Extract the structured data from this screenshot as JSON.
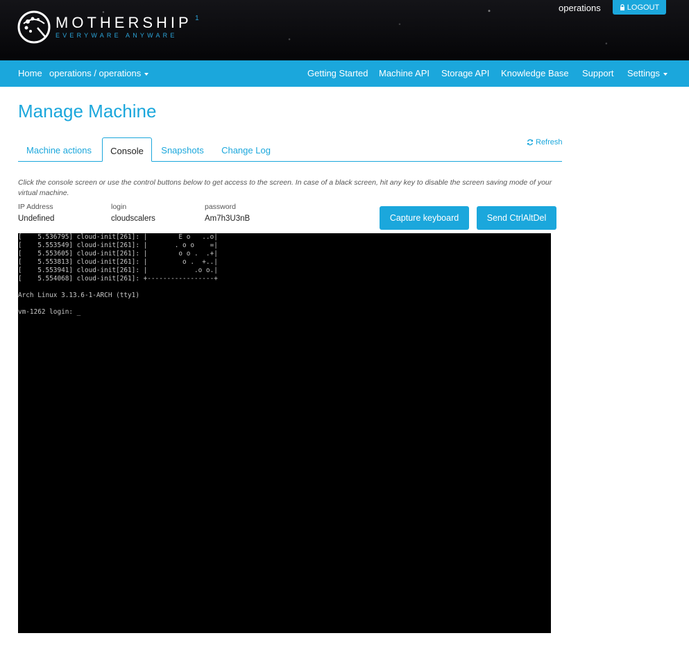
{
  "header": {
    "logo_word": "MOTHERSHIP",
    "logo_superscript": "1",
    "logo_tagline": "EVERYWARE ANYWARE",
    "user": "operations",
    "logout_label": "LOGOUT",
    "logout_icon": "lock-icon"
  },
  "nav": {
    "home": "Home",
    "context": "operations / operations",
    "items": [
      "Getting Started",
      "Machine API",
      "Storage API",
      "Knowledge Base",
      "Support"
    ],
    "settings": "Settings"
  },
  "page": {
    "title": "Manage Machine",
    "refresh": "Refresh",
    "tabs": [
      "Machine actions",
      "Console",
      "Snapshots",
      "Change Log"
    ],
    "active_tab": "Console",
    "hint": "Click the console screen or use the control buttons below to get access to the screen. In case of a black screen, hit any key to disable the screen saving mode of your virtual machine."
  },
  "machine": {
    "ip_label": "IP Address",
    "ip_value": "Undefined",
    "login_label": "login",
    "login_value": "cloudscalers",
    "password_label": "password",
    "password_value": "Am7h3U3nB"
  },
  "buttons": {
    "capture": "Capture keyboard",
    "ctrlaltdel": "Send CtrlAltDel"
  },
  "console": {
    "lines": [
      "[    5.536795] cloud-init[261]: |        E o   ..o|",
      "[    5.553549] cloud-init[261]: |       . o o    =|",
      "[    5.553605] cloud-init[261]: |        o o .  .+|",
      "[    5.553813] cloud-init[261]: |         o .  +..|",
      "[    5.553941] cloud-init[261]: |            .o o.|",
      "[    5.554068] cloud-init[261]: +-----------------+",
      "",
      "Arch Linux 3.13.6-1-ARCH (tty1)",
      "",
      "vm-1262 login: _"
    ]
  },
  "colors": {
    "accent": "#1ba7dc",
    "header_bg": "#0b0b0e",
    "console_bg": "#000000"
  }
}
